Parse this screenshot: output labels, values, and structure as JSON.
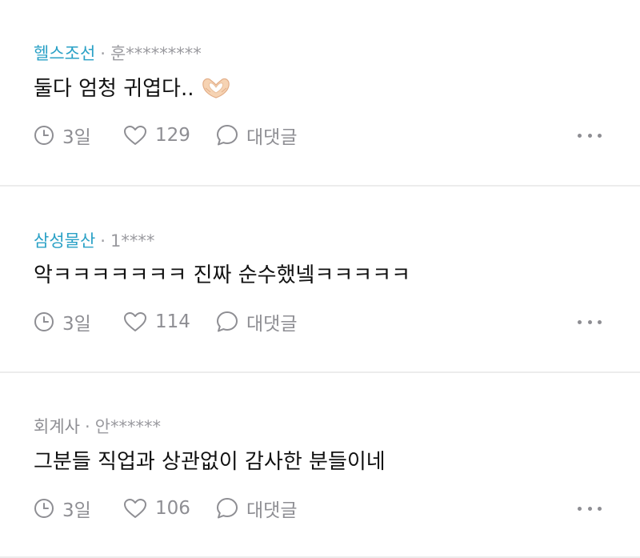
{
  "comments": [
    {
      "company": "헬스조선",
      "dot": "·",
      "user": "훈*********",
      "text": "둘다 엄청 귀엽다..",
      "emoji": "heart-hands",
      "time": "3일",
      "likes": "129",
      "reply": "대댓글"
    },
    {
      "company": "삼성물산",
      "dot": "·",
      "user": "1****",
      "text": "악ㅋㅋㅋㅋㅋㅋㅋ 진짜 순수했넼ㅋㅋㅋㅋㅋ",
      "time": "3일",
      "likes": "114",
      "reply": "대댓글"
    },
    {
      "company": "회계사",
      "dot": "·",
      "user": "안******",
      "text": "그분들 직업과 상관없이 감사한 분들이네",
      "time": "3일",
      "likes": "106",
      "reply": "대댓글"
    }
  ],
  "colors": {
    "accent": "#2aa1c6",
    "muted": "#8e8e93",
    "divider": "#ececec"
  },
  "icons": [
    "clock-icon",
    "heart-icon",
    "speech-bubble-icon",
    "more-dots-icon"
  ]
}
